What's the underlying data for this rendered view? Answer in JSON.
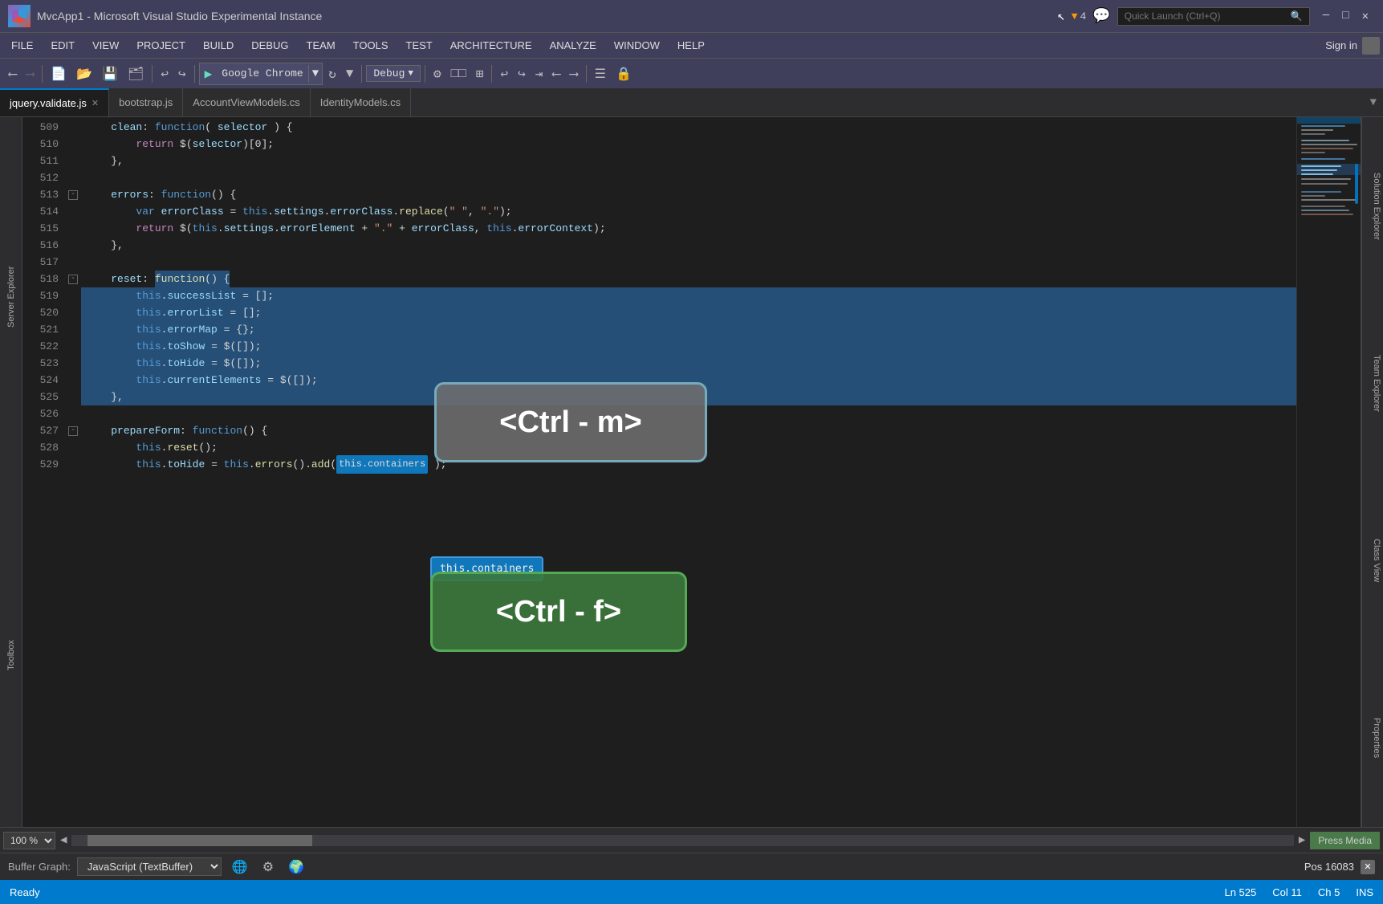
{
  "window": {
    "title": "MvcApp1 - Microsoft Visual Studio Experimental Instance",
    "logo": "VS"
  },
  "titlebar": {
    "search_placeholder": "Quick Launch (Ctrl+Q)",
    "notification_count": "4",
    "controls": [
      "minimize",
      "maximize",
      "close"
    ]
  },
  "menubar": {
    "items": [
      "FILE",
      "EDIT",
      "VIEW",
      "PROJECT",
      "BUILD",
      "DEBUG",
      "TEAM",
      "TOOLS",
      "TEST",
      "ARCHITECTURE",
      "ANALYZE",
      "WINDOW",
      "HELP"
    ],
    "signin": "Sign in"
  },
  "toolbar": {
    "run_label": "Google Chrome",
    "config_label": "Debug"
  },
  "tabs": [
    {
      "label": "jquery.validate.js",
      "active": true
    },
    {
      "label": "bootstrap.js",
      "active": false
    },
    {
      "label": "AccountViewModels.cs",
      "active": false
    },
    {
      "label": "IdentityModels.cs",
      "active": false
    }
  ],
  "editor": {
    "lines": [
      {
        "num": 509,
        "indent": 0,
        "code": "    clean: function( selector ) {",
        "selected": false,
        "has_collapse": false
      },
      {
        "num": 510,
        "indent": 1,
        "code": "        return $(selector)[0];",
        "selected": false,
        "has_collapse": false
      },
      {
        "num": 511,
        "indent": 0,
        "code": "    },",
        "selected": false,
        "has_collapse": false
      },
      {
        "num": 512,
        "indent": 0,
        "code": "",
        "selected": false,
        "has_collapse": false
      },
      {
        "num": 513,
        "indent": 0,
        "code": "    errors: function() {",
        "selected": false,
        "has_collapse": true
      },
      {
        "num": 514,
        "indent": 1,
        "code": "        var errorClass = this.settings.errorClass.replace(\" \", \".\");",
        "selected": false,
        "has_collapse": false
      },
      {
        "num": 515,
        "indent": 1,
        "code": "        return $(this.settings.errorElement + \".\" + errorClass, this.errorContext);",
        "selected": false,
        "has_collapse": false
      },
      {
        "num": 516,
        "indent": 0,
        "code": "    },",
        "selected": false,
        "has_collapse": false
      },
      {
        "num": 517,
        "indent": 0,
        "code": "",
        "selected": false,
        "has_collapse": false
      },
      {
        "num": 518,
        "indent": 0,
        "code": "    reset: function() {",
        "selected": false,
        "has_collapse": true
      },
      {
        "num": 519,
        "indent": 1,
        "code": "        this.successList = [];",
        "selected": true,
        "has_collapse": false
      },
      {
        "num": 520,
        "indent": 1,
        "code": "        this.errorList = [];",
        "selected": true,
        "has_collapse": false
      },
      {
        "num": 521,
        "indent": 1,
        "code": "        this.errorMap = {};",
        "selected": true,
        "has_collapse": false
      },
      {
        "num": 522,
        "indent": 1,
        "code": "        this.toShow = $([]);",
        "selected": true,
        "has_collapse": false
      },
      {
        "num": 523,
        "indent": 1,
        "code": "        this.toHide = $([]);",
        "selected": true,
        "has_collapse": false
      },
      {
        "num": 524,
        "indent": 1,
        "code": "        this.currentElements = $([]);",
        "selected": true,
        "has_collapse": false
      },
      {
        "num": 525,
        "indent": 0,
        "code": "    },",
        "selected": true,
        "has_collapse": false
      },
      {
        "num": 526,
        "indent": 0,
        "code": "",
        "selected": false,
        "has_collapse": false
      },
      {
        "num": 527,
        "indent": 0,
        "code": "    prepareForm: function() {",
        "selected": false,
        "has_collapse": true
      },
      {
        "num": 528,
        "indent": 1,
        "code": "        this.reset();",
        "selected": false,
        "has_collapse": false
      },
      {
        "num": 529,
        "indent": 1,
        "code": "        this.toHide = this.errors().add(this.containers );",
        "selected": false,
        "has_collapse": false
      }
    ]
  },
  "kbd_overlays": {
    "ctrl_m": "<Ctrl - m>",
    "ctrl_f": "<Ctrl - f>",
    "tooltip_containers": "this.containers"
  },
  "sidebar_left": {
    "labels": [
      "Server Explorer",
      "Toolbox"
    ]
  },
  "sidebar_right": {
    "labels": [
      "Solution Explorer",
      "Team Explorer",
      "Class View",
      "Properties"
    ]
  },
  "bottom_toolbar": {
    "zoom": "100 %",
    "press_media": "Press Media"
  },
  "buffer_graph": {
    "label": "Buffer Graph:",
    "value": "JavaScript (TextBuffer)",
    "pos": "Pos 16083"
  },
  "statusbar": {
    "ready": "Ready",
    "ln": "Ln 525",
    "col": "Col 11",
    "ch": "Ch 5",
    "ins": "INS"
  }
}
